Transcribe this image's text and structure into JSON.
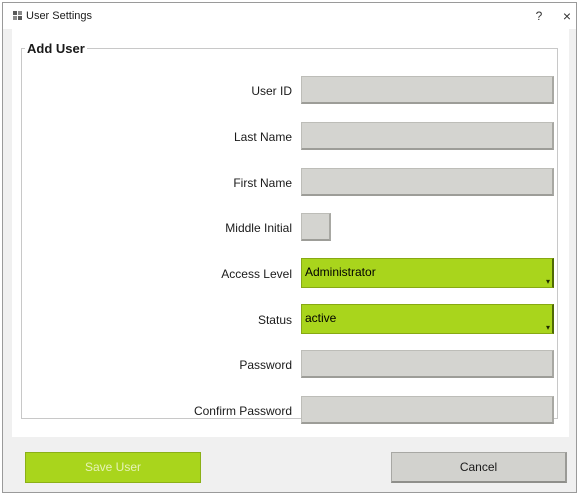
{
  "window": {
    "title": "User Settings",
    "help_label": "?",
    "close_label": "×",
    "icon": "app-grid-icon"
  },
  "group": {
    "title": "Add User"
  },
  "form": {
    "user_id_label": "User ID",
    "user_id_value": "",
    "last_name_label": "Last Name",
    "last_name_value": "",
    "first_name_label": "First Name",
    "first_name_value": "",
    "middle_initial_label": "Middle Initial",
    "middle_initial_value": "",
    "access_level_label": "Access Level",
    "access_level_value": "Administrator",
    "status_label": "Status",
    "status_value": "active",
    "password_label": "Password",
    "password_value": "",
    "confirm_password_label": "Confirm Password",
    "confirm_password_value": ""
  },
  "buttons": {
    "save_label": "Save User",
    "cancel_label": "Cancel"
  },
  "colors": {
    "accent": "#a9d51c",
    "field_bg": "#d4d4d0"
  }
}
